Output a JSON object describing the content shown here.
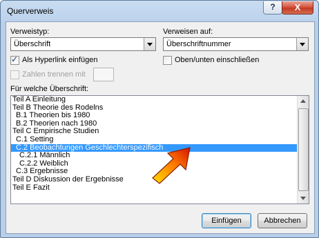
{
  "window": {
    "title": "Querverweis",
    "help_label": "?",
    "close_label": "X"
  },
  "verweistyp": {
    "label": "Verweistyp:",
    "value": "Überschrift"
  },
  "verweisen_auf": {
    "label": "Verweisen auf:",
    "value": "Überschriftnummer"
  },
  "hyperlink": {
    "label": "Als Hyperlink einfügen",
    "checked": true
  },
  "oben_unten": {
    "label": "Oben/unten einschließen",
    "checked": false
  },
  "zahlen_trennen": {
    "label": "Zahlen trennen mit",
    "checked": false,
    "enabled": false
  },
  "list": {
    "label": "Für welche Überschrift:",
    "items": [
      "Teil A Einleitung",
      "Teil B Theorie des Rodelns",
      "  B.1 Theorien bis 1980",
      "  B.2 Theorien nach 1980",
      "Teil C Empirische Studien",
      "  C.1 Setting",
      "  C.2 Beobachtungen Geschlechterspezifisch",
      "    C.2.1 Männlich",
      "    C.2.2 Weiblich",
      "  C.3 Ergebnisse",
      "Teil D Diskussion der Ergebnisse",
      "Teil E Fazit"
    ],
    "selected_index": 6
  },
  "buttons": {
    "insert": "Einfügen",
    "cancel": "Abbrechen"
  },
  "colors": {
    "selection": "#3399ff",
    "arrow_top": "#ffd400",
    "arrow_bottom": "#e01a00"
  }
}
